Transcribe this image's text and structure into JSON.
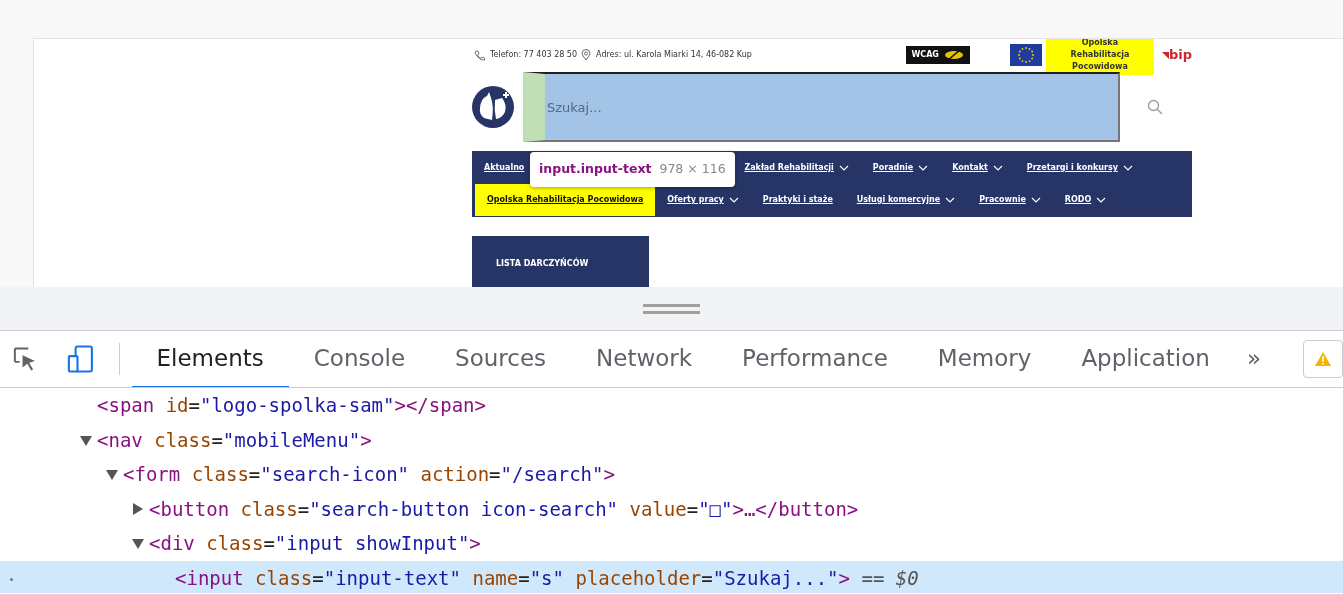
{
  "page": {
    "contact": [
      {
        "kind": "phone",
        "text": "Telefon: 77 403 28 50"
      },
      {
        "kind": "address",
        "text": "Adres: ul. Karola Miarki 14, 46-082 Kup"
      }
    ],
    "badges": {
      "wcag": "WCAG",
      "highlight": "Opolska Rehabilitacja Pocowidowa",
      "bip": "bip"
    },
    "search": {
      "placeholder": "Szukaj..."
    },
    "menu_rows": [
      [
        {
          "label": "Aktualno",
          "dropdown": false,
          "selected": false
        },
        {
          "label": "Zakład Rehabilitacji",
          "dropdown": true,
          "selected": false
        },
        {
          "label": "Poradnie",
          "dropdown": true,
          "selected": false
        },
        {
          "label": "Kontakt",
          "dropdown": true,
          "selected": false
        },
        {
          "label": "Przetargi i konkursy",
          "dropdown": true,
          "selected": false
        }
      ],
      [
        {
          "label": "Opolska Rehabilitacja Pocowidowa",
          "dropdown": false,
          "selected": true
        },
        {
          "label": "Oferty pracy",
          "dropdown": true,
          "selected": false
        },
        {
          "label": "Praktyki i staże",
          "dropdown": false,
          "selected": false
        },
        {
          "label": "Usługi komercyjne",
          "dropdown": true,
          "selected": false
        },
        {
          "label": "Pracownie",
          "dropdown": true,
          "selected": false
        },
        {
          "label": "RODO",
          "dropdown": true,
          "selected": false
        }
      ]
    ],
    "sidebar_button": "LISTA DARCZYŃCÓW",
    "tooltip": {
      "selector": "input.input-text",
      "size": "978 × 116"
    }
  },
  "devtools": {
    "tabs": [
      {
        "label": "Elements",
        "selected": true
      },
      {
        "label": "Console",
        "selected": false
      },
      {
        "label": "Sources",
        "selected": false
      },
      {
        "label": "Network",
        "selected": false
      },
      {
        "label": "Performance",
        "selected": false
      },
      {
        "label": "Memory",
        "selected": false
      },
      {
        "label": "Application",
        "selected": false
      }
    ],
    "more": "»",
    "tree": [
      {
        "selected": false,
        "tokens": [
          {
            "kind": "tag",
            "text": "<span"
          },
          {
            "kind": "attr",
            "text": " id"
          },
          {
            "kind": "punct",
            "text": "="
          },
          {
            "kind": "value",
            "text": "\"logo-spolka-sam\""
          },
          {
            "kind": "tag",
            "text": "></span>"
          }
        ]
      },
      {
        "selected": false,
        "expanded": true,
        "tokens": [
          {
            "kind": "tag",
            "text": "<nav"
          },
          {
            "kind": "attr",
            "text": " class"
          },
          {
            "kind": "punct",
            "text": "="
          },
          {
            "kind": "value",
            "text": "\"mobileMenu\""
          },
          {
            "kind": "tag",
            "text": ">"
          }
        ],
        "children": [
          {
            "selected": false,
            "expanded": true,
            "tokens": [
              {
                "kind": "tag",
                "text": "<form"
              },
              {
                "kind": "attr",
                "text": " class"
              },
              {
                "kind": "punct",
                "text": "="
              },
              {
                "kind": "value",
                "text": "\"search-icon\""
              },
              {
                "kind": "attr",
                "text": " action"
              },
              {
                "kind": "punct",
                "text": "="
              },
              {
                "kind": "value",
                "text": "\"/search\""
              },
              {
                "kind": "tag",
                "text": ">"
              }
            ],
            "children": [
              {
                "selected": false,
                "expanded": false,
                "tokens": [
                  {
                    "kind": "tag",
                    "text": "<button"
                  },
                  {
                    "kind": "attr",
                    "text": " class"
                  },
                  {
                    "kind": "punct",
                    "text": "="
                  },
                  {
                    "kind": "value",
                    "text": "\"search-button icon-search\""
                  },
                  {
                    "kind": "attr",
                    "text": " value"
                  },
                  {
                    "kind": "punct",
                    "text": "="
                  },
                  {
                    "kind": "value",
                    "text": "\"□\""
                  },
                  {
                    "kind": "tag",
                    "text": ">"
                  },
                  {
                    "kind": "punct",
                    "text": "…"
                  },
                  {
                    "kind": "tag",
                    "text": "</button>"
                  }
                ]
              },
              {
                "selected": false,
                "expanded": true,
                "tokens": [
                  {
                    "kind": "tag",
                    "text": "<div"
                  },
                  {
                    "kind": "attr",
                    "text": " class"
                  },
                  {
                    "kind": "punct",
                    "text": "="
                  },
                  {
                    "kind": "value",
                    "text": "\"input showInput\""
                  },
                  {
                    "kind": "tag",
                    "text": ">"
                  }
                ],
                "children": [
                  {
                    "selected": true,
                    "tokens": [
                      {
                        "kind": "tag",
                        "text": "<input"
                      },
                      {
                        "kind": "attr",
                        "text": " class"
                      },
                      {
                        "kind": "punct",
                        "text": "="
                      },
                      {
                        "kind": "value",
                        "text": "\"input-text\""
                      },
                      {
                        "kind": "attr",
                        "text": " name"
                      },
                      {
                        "kind": "punct",
                        "text": "="
                      },
                      {
                        "kind": "value",
                        "text": "\"s\""
                      },
                      {
                        "kind": "attr",
                        "text": " placeholder"
                      },
                      {
                        "kind": "punct",
                        "text": "="
                      },
                      {
                        "kind": "value",
                        "text": "\"Szukaj...\""
                      },
                      {
                        "kind": "tag",
                        "text": ">"
                      },
                      {
                        "kind": "ref",
                        "text": " == $0"
                      }
                    ]
                  }
                ]
              }
            ]
          }
        ]
      }
    ]
  }
}
